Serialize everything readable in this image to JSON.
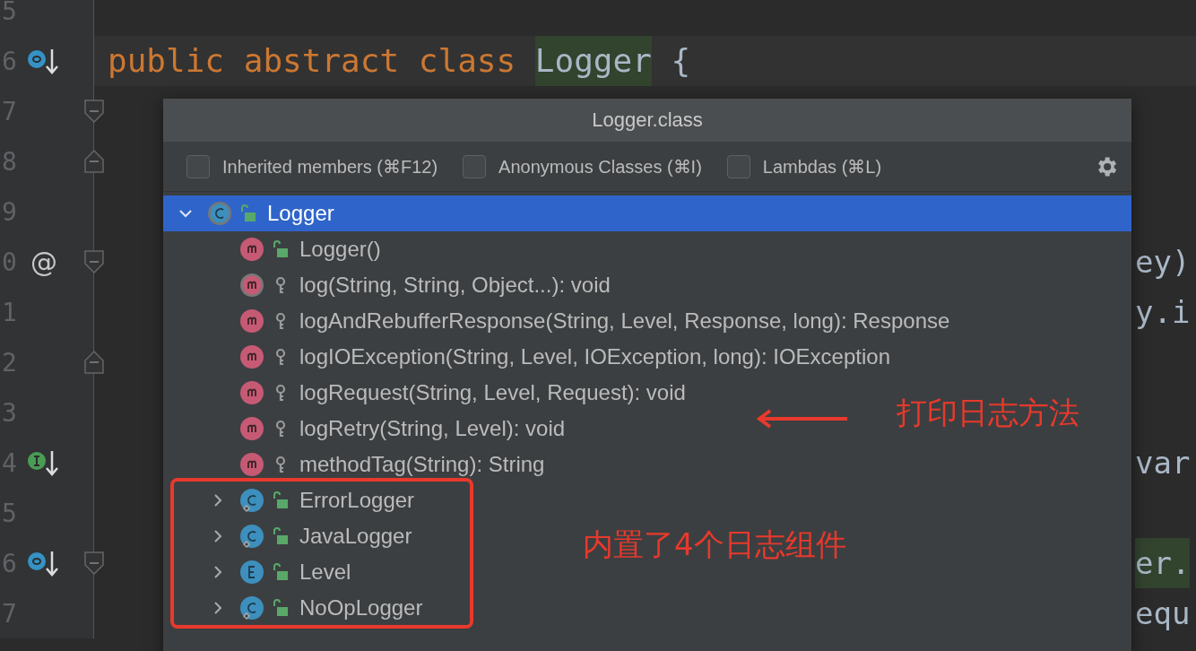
{
  "editor": {
    "lines": [
      {
        "number": "5"
      },
      {
        "number": "6",
        "marker": {
          "kind": "override"
        },
        "current": true,
        "code": [
          {
            "kind": "keyword",
            "text": "public abstract class "
          },
          {
            "kind": "match",
            "text": "Logger"
          },
          {
            "kind": "plain",
            "text": " {"
          }
        ]
      },
      {
        "number": "7",
        "fold": {
          "kind": "start"
        }
      },
      {
        "number": "8",
        "fold": {
          "kind": "end"
        }
      },
      {
        "number": "9"
      },
      {
        "number": "0",
        "glyph": "@",
        "fold": {
          "kind": "start"
        },
        "tail": {
          "kind": "plain",
          "text": "ey)"
        }
      },
      {
        "number": "1",
        "tail": {
          "kind": "plain",
          "text": "y.i"
        }
      },
      {
        "number": "2",
        "fold": {
          "kind": "end"
        }
      },
      {
        "number": "3"
      },
      {
        "number": "4",
        "marker": {
          "kind": "implements"
        },
        "tail": {
          "kind": "plain",
          "text": "var"
        }
      },
      {
        "number": "5"
      },
      {
        "number": "6",
        "marker": {
          "kind": "override"
        },
        "fold": {
          "kind": "start"
        },
        "tail": {
          "kind": "match",
          "text": "er."
        }
      },
      {
        "number": "7",
        "tail": {
          "kind": "plain",
          "text": "equ"
        }
      }
    ]
  },
  "popup": {
    "title": "Logger.class",
    "options": [
      {
        "label": "Inherited members (⌘F12)",
        "checked": false
      },
      {
        "label": "Anonymous Classes (⌘I)",
        "checked": false
      },
      {
        "label": "Lambdas (⌘L)",
        "checked": false
      }
    ],
    "tree": [
      {
        "kind": "class",
        "label": "Logger",
        "visibility": {
          "kind": "public"
        },
        "abstract": true,
        "static": false,
        "expanded": true,
        "selected": true,
        "children": [
          {
            "kind": "method",
            "label": "Logger()",
            "visibility": {
              "kind": "public"
            },
            "abstract": false,
            "selected": false
          },
          {
            "kind": "method",
            "label": "log(String, String, Object...): void",
            "visibility": {
              "kind": "package"
            },
            "abstract": true,
            "selected": false
          },
          {
            "kind": "method",
            "label": "logAndRebufferResponse(String, Level, Response, long): Response",
            "visibility": {
              "kind": "package"
            },
            "abstract": false,
            "selected": false
          },
          {
            "kind": "method",
            "label": "logIOException(String, Level, IOException, long): IOException",
            "visibility": {
              "kind": "package"
            },
            "abstract": false,
            "selected": false
          },
          {
            "kind": "method",
            "label": "logRequest(String, Level, Request): void",
            "visibility": {
              "kind": "package"
            },
            "abstract": false,
            "selected": false
          },
          {
            "kind": "method",
            "label": "logRetry(String, Level): void",
            "visibility": {
              "kind": "package"
            },
            "abstract": false,
            "selected": false
          },
          {
            "kind": "method",
            "label": "methodTag(String): String",
            "visibility": {
              "kind": "package"
            },
            "abstract": false,
            "selected": false
          },
          {
            "kind": "class",
            "label": "ErrorLogger",
            "visibility": {
              "kind": "public"
            },
            "abstract": false,
            "static": true,
            "expanded": false,
            "selected": false
          },
          {
            "kind": "class",
            "label": "JavaLogger",
            "visibility": {
              "kind": "public"
            },
            "abstract": false,
            "static": true,
            "expanded": false,
            "selected": false
          },
          {
            "kind": "enum",
            "label": "Level",
            "visibility": {
              "kind": "public"
            },
            "abstract": false,
            "static": false,
            "expanded": false,
            "selected": false
          },
          {
            "kind": "class",
            "label": "NoOpLogger",
            "visibility": {
              "kind": "public"
            },
            "abstract": false,
            "static": true,
            "expanded": false,
            "selected": false
          }
        ]
      }
    ]
  },
  "annotations": [
    {
      "kind": "arrow-note",
      "text": "打印日志方法"
    },
    {
      "kind": "box-note",
      "text": "内置了4个日志组件"
    }
  ]
}
